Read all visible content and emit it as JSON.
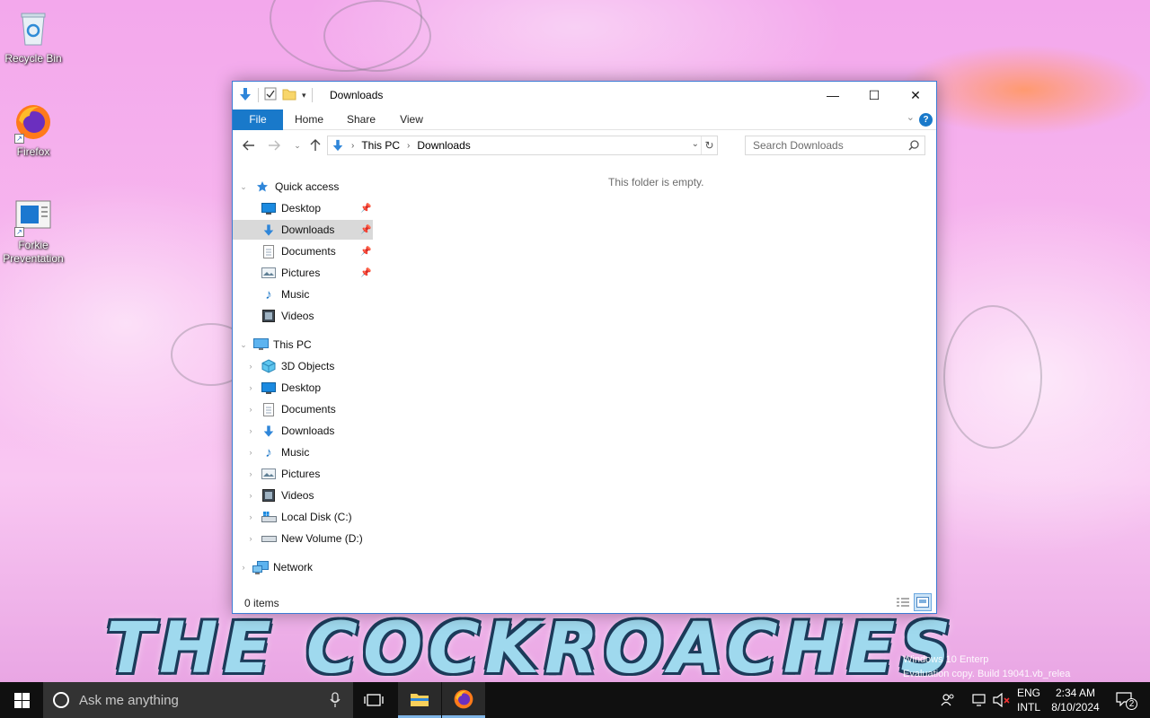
{
  "desktop": {
    "icons": [
      {
        "label": "Recycle Bin",
        "icon": "recycle-bin-icon"
      },
      {
        "label": "Firefox",
        "icon": "firefox-icon"
      },
      {
        "label": "Forkie Preventation",
        "icon": "app-window-icon"
      }
    ],
    "wallpaper_text": "THE COCKROACHES",
    "watermark": [
      "Windows 10 Enterp",
      "Evaluation copy. Build 19041.vb_relea"
    ]
  },
  "explorer": {
    "title": "Downloads",
    "caption": {
      "minimize": "—",
      "maximize": "☐",
      "close": "✕"
    },
    "ribbon_tabs": {
      "file": "File",
      "home": "Home",
      "share": "Share",
      "view": "View"
    },
    "address": {
      "crumbs": [
        "This PC",
        "Downloads"
      ]
    },
    "search_placeholder": "Search Downloads",
    "nav": {
      "quick_access": "Quick access",
      "quick_items": [
        "Desktop",
        "Downloads",
        "Documents",
        "Pictures",
        "Music",
        "Videos"
      ],
      "this_pc": "This PC",
      "pc_items": [
        "3D Objects",
        "Desktop",
        "Documents",
        "Downloads",
        "Music",
        "Pictures",
        "Videos",
        "Local Disk (C:)",
        "New Volume (D:)"
      ],
      "network": "Network"
    },
    "empty_message": "This folder is empty.",
    "status": "0 items",
    "selected_nav_item": "Downloads"
  },
  "taskbar": {
    "search_placeholder": "Ask me anything",
    "lang": [
      "ENG",
      "INTL"
    ],
    "time": "2:34 AM",
    "date": "8/10/2024",
    "notifications": "2"
  },
  "colors": {
    "accent": "#1979ca",
    "taskbar": "#101010",
    "selection": "#d9d9d9"
  }
}
